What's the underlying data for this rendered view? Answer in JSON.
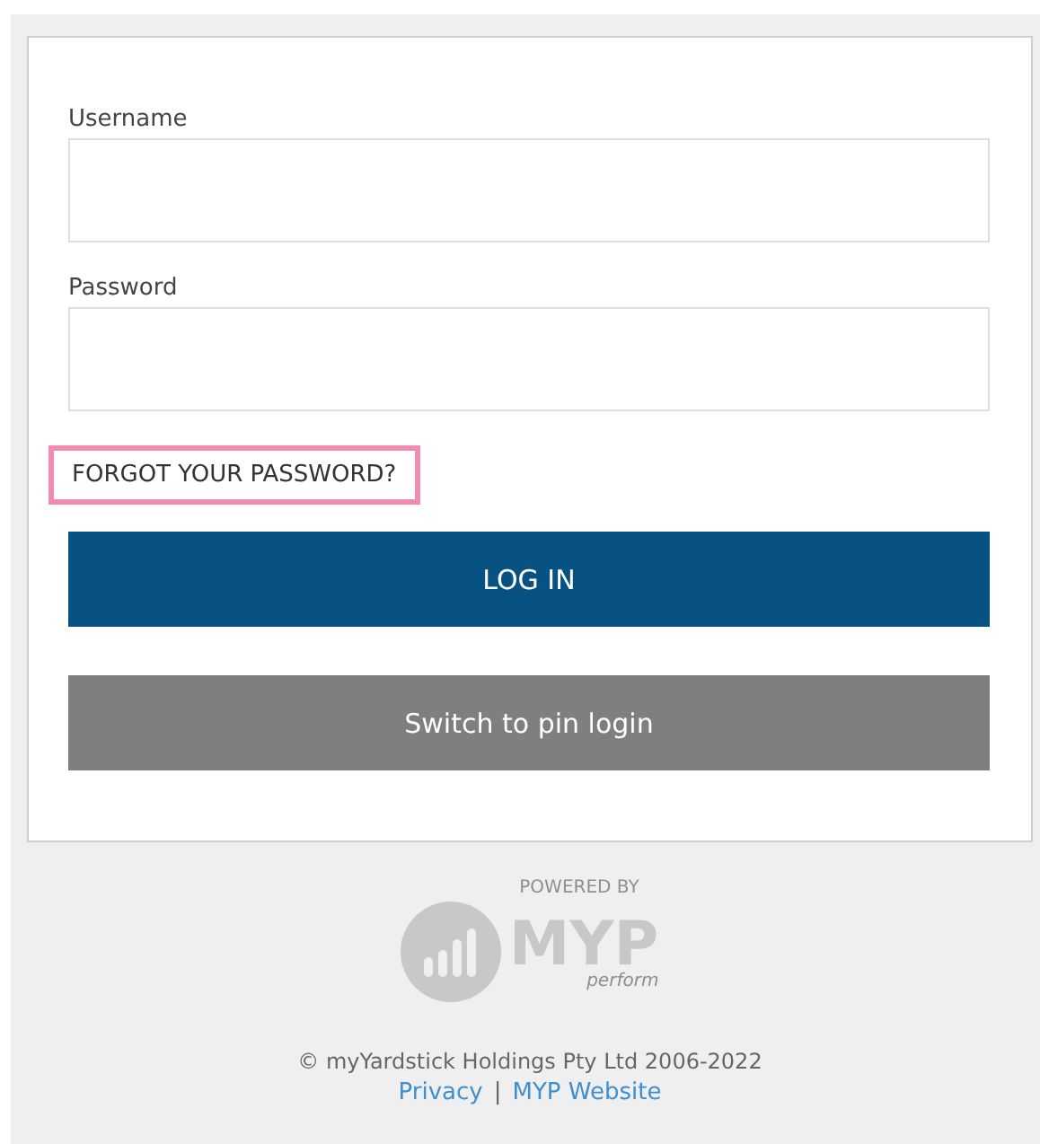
{
  "form": {
    "fields": [
      {
        "label": "Username"
      },
      {
        "label": "Password"
      }
    ],
    "forgot_link": {
      "text": "FORGOT YOUR PASSWORD?",
      "highlighted": true
    },
    "buttons": [
      {
        "label": "LOG IN",
        "kind": "primary"
      },
      {
        "label": "Switch to pin login",
        "kind": "secondary"
      }
    ]
  },
  "footer": {
    "powered_by": "POWERED BY",
    "logo_text": "MYP",
    "logo_tagline": "perform",
    "copyright": "© myYardstick Holdings Pty Ltd 2006-2022",
    "links": [
      "Privacy",
      "MYP Website"
    ],
    "separator": "|"
  }
}
